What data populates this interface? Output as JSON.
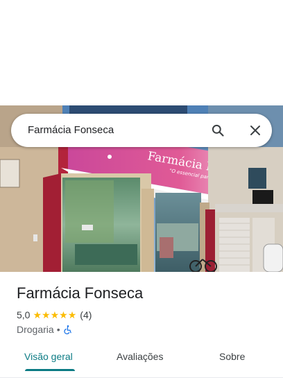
{
  "search": {
    "query": "Farmácia Fonseca",
    "search_icon": "search-icon",
    "close_icon": "close-icon"
  },
  "photo": {
    "sign_text": "Farmácia Fonseca",
    "sign_slogan": "O essencial para sua saúde"
  },
  "place": {
    "name": "Farmácia Fonseca",
    "rating": "5,0",
    "stars": 5,
    "review_count": "(4)",
    "category": "Drogaria",
    "separator": "•",
    "accessibility_icon": "wheelchair-icon"
  },
  "tabs": [
    {
      "label": "Visão geral",
      "active": true
    },
    {
      "label": "Avaliações",
      "active": false
    },
    {
      "label": "Sobre",
      "active": false
    }
  ],
  "colors": {
    "accent": "#0b7b84",
    "star": "#fbbc04",
    "sign_pink": "#d63a8a"
  }
}
